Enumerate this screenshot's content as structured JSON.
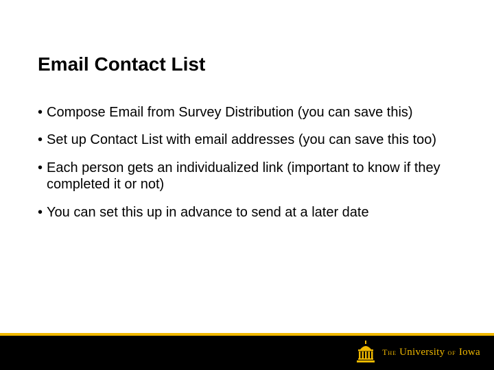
{
  "slide": {
    "title": "Email Contact List",
    "bullets": [
      "Compose Email from Survey Distribution (you can save this)",
      "Set up Contact List with email addresses (you can save this too)",
      "Each person gets an individualized link (important to know if they completed it or not)",
      "You can set this up in advance to send at a later date"
    ]
  },
  "branding": {
    "institution_prefix": "The",
    "institution_main": "University",
    "institution_of": "of",
    "institution_name": "Iowa",
    "colors": {
      "gold": "#f0b800",
      "black": "#000000"
    }
  }
}
